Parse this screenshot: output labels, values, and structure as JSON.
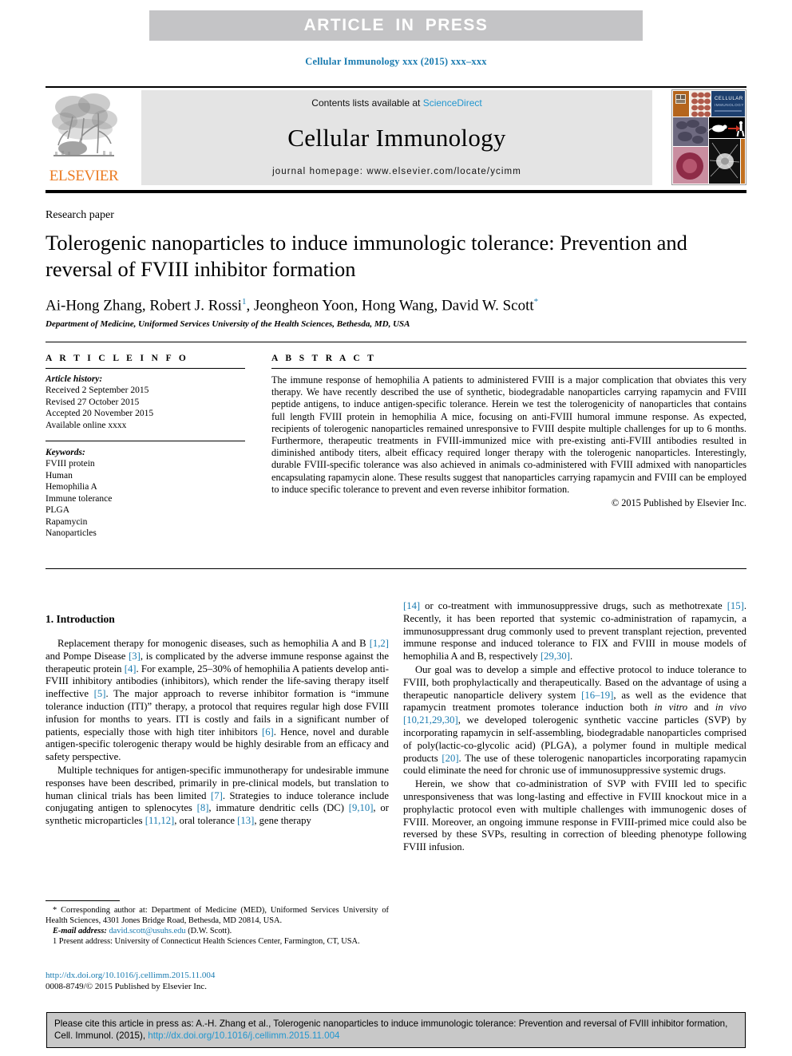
{
  "banner": {
    "text": "ARTICLE  IN  PRESS"
  },
  "journal_ref": "Cellular Immunology xxx (2015) xxx–xxx",
  "masthead": {
    "publisher": "ELSEVIER",
    "contents_prefix": "Contents lists available at ",
    "contents_link": "ScienceDirect",
    "journal_title": "Cellular Immunology",
    "homepage": "journal homepage: www.elsevier.com/locate/ycimm",
    "cover_title_line1": "CELLULAR",
    "cover_title_line2": "IMMUNOLOGY"
  },
  "article": {
    "kind": "Research paper",
    "title": "Tolerogenic nanoparticles to induce immunologic tolerance: Prevention and reversal of FVIII inhibitor formation",
    "authors_pre": "Ai-Hong Zhang, Robert J. Rossi",
    "authors_sup1": "1",
    "authors_mid": ", Jeongheon Yoon, Hong Wang, David W. Scott",
    "authors_sup2": "*",
    "affiliation": "Department of Medicine, Uniformed Services University of the Health Sciences, Bethesda, MD, USA"
  },
  "info": {
    "heading": "A R T I C L E  I N F O",
    "history_label": "Article history:",
    "history": [
      "Received 2 September 2015",
      "Revised 27 October 2015",
      "Accepted 20 November 2015",
      "Available online xxxx"
    ],
    "keywords_label": "Keywords:",
    "keywords": [
      "FVIII protein",
      "Human",
      "Hemophilia A",
      "Immune tolerance",
      "PLGA",
      "Rapamycin",
      "Nanoparticles"
    ]
  },
  "abstract": {
    "heading": "A B S T R A C T",
    "text": "The immune response of hemophilia A patients to administered FVIII is a major complication that obviates this very therapy. We have recently described the use of synthetic, biodegradable nanoparticles carrying rapamycin and FVIII peptide antigens, to induce antigen-specific tolerance. Herein we test the tolerogenicity of nanoparticles that contains full length FVIII protein in hemophilia A mice, focusing on anti-FVIII humoral immune response. As expected, recipients of tolerogenic nanoparticles remained unresponsive to FVIII despite multiple challenges for up to 6 months. Furthermore, therapeutic treatments in FVIII-immunized mice with pre-existing anti-FVIII antibodies resulted in diminished antibody titers, albeit efficacy required longer therapy with the tolerogenic nanoparticles. Interestingly, durable FVIII-specific tolerance was also achieved in animals co-administered with FVIII admixed with nanoparticles encapsulating rapamycin alone. These results suggest that nanoparticles carrying rapamycin and FVIII can be employed to induce specific tolerance to prevent and even reverse inhibitor formation.",
    "copyright": "© 2015 Published by Elsevier Inc."
  },
  "body": {
    "section_title": "1. Introduction",
    "left_paragraphs": [
      "Replacement therapy for monogenic diseases, such as hemophilia A and B [1,2] and Pompe Disease [3], is complicated by the adverse immune response against the therapeutic protein [4]. For example, 25–30% of hemophilia A patients develop anti-FVIII inhibitory antibodies (inhibitors), which render the life-saving therapy itself ineffective [5]. The major approach to reverse inhibitor formation is “immune tolerance induction (ITI)” therapy, a protocol that requires regular high dose FVIII infusion for months to years. ITI is costly and fails in a significant number of patients, especially those with high titer inhibitors [6]. Hence, novel and durable antigen-specific tolerogenic therapy would be highly desirable from an efficacy and safety perspective.",
      "Multiple techniques for antigen-specific immunotherapy for undesirable immune responses have been described, primarily in pre-clinical models, but translation to human clinical trials has been limited [7]. Strategies to induce tolerance include conjugating antigen to splenocytes [8], immature dendritic cells (DC) [9,10], or synthetic microparticles [11,12], oral tolerance [13], gene therapy"
    ],
    "right_paragraphs": [
      "[14] or co-treatment with immunosuppressive drugs, such as methotrexate [15]. Recently, it has been reported that systemic co-administration of rapamycin, a immunosuppressant drug commonly used to prevent transplant rejection, prevented immune response and induced tolerance to FIX and FVIII in mouse models of hemophilia A and B, respectively [29,30].",
      "Our goal was to develop a simple and effective protocol to induce tolerance to FVIII, both prophylactically and therapeutically. Based on the advantage of using a therapeutic nanoparticle delivery system [16–19], as well as the evidence that rapamycin treatment promotes tolerance induction both in vitro and in vivo [10,21,29,30], we developed tolerogenic synthetic vaccine particles (SVP) by incorporating rapamycin in self-assembling, biodegradable nanoparticles comprised of poly(lactic-co-glycolic acid) (PLGA), a polymer found in multiple medical products [20]. The use of these tolerogenic nanoparticles incorporating rapamycin could eliminate the need for chronic use of immunosuppressive systemic drugs.",
      "Herein, we show that co-administration of SVP with FVIII led to specific unresponsiveness that was long-lasting and effective in FVIII knockout mice in a prophylactic protocol even with multiple challenges with immunogenic doses of FVIII. Moreover, an ongoing immune response in FVIII-primed mice could also be reversed by these SVPs, resulting in correction of bleeding phenotype following FVIII infusion."
    ]
  },
  "footnote": {
    "corresponding": "* Corresponding author at: Department of Medicine (MED), Uniformed Services University of Health Sciences, 4301 Jones Bridge Road, Bethesda, MD 20814, USA.",
    "email_label": "E-mail address:",
    "email": "david.scott@usuhs.edu",
    "email_owner": "(D.W. Scott).",
    "present_address": "1  Present address: University of Connecticut Health Sciences Center, Farmington, CT, USA."
  },
  "doi_block": {
    "doi": "http://dx.doi.org/10.1016/j.cellimm.2015.11.004",
    "issn": "0008-8749/© 2015 Published by Elsevier Inc."
  },
  "cite_box": {
    "text_before": "Please cite this article in press as: A.-H. Zhang et al., Tolerogenic nanoparticles to induce immunologic tolerance: Prevention and reversal of FVIII inhibitor formation, Cell. Immunol. (2015), ",
    "doi": "http://dx.doi.org/10.1016/j.cellimm.2015.11.004"
  },
  "colors": {
    "link_blue": "#1a7bb0",
    "banner_gray": "#c4c4c6",
    "band_gray": "#e4e4e4",
    "elsevier_orange": "#eb7b22"
  }
}
